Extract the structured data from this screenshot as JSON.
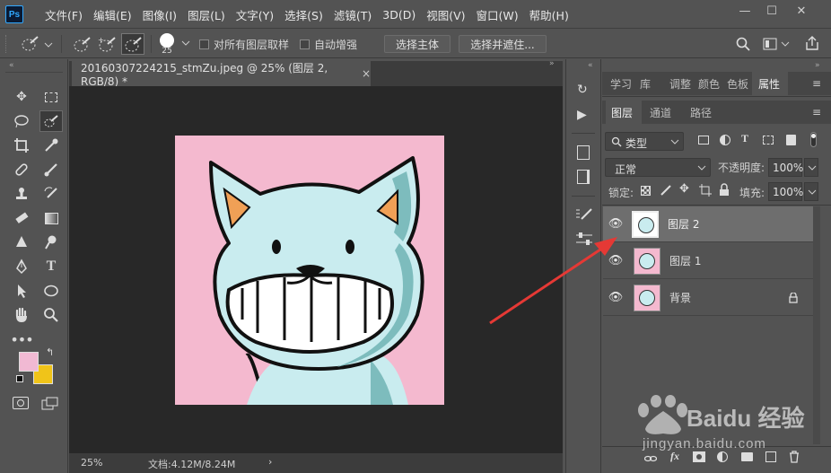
{
  "menubar": {
    "logo": "Ps",
    "items": [
      "文件(F)",
      "编辑(E)",
      "图像(I)",
      "图层(L)",
      "文字(Y)",
      "选择(S)",
      "滤镜(T)",
      "3D(D)",
      "视图(V)",
      "窗口(W)",
      "帮助(H)"
    ]
  },
  "options": {
    "brush_size": "25",
    "sample_all_label": "对所有图层取样",
    "auto_enhance_label": "自动增强",
    "select_subject_label": "选择主体",
    "select_mask_label": "选择并遮住..."
  },
  "document": {
    "tab_title": "20160307224215_stmZu.jpeg @ 25% (图层 2, RGB/8) *",
    "close": "×",
    "zoom": "25%",
    "doc_info": "文档:4.12M/8.24M",
    "arrow": "›"
  },
  "colors": {
    "foreground": "#f1b9d3",
    "background": "#f0c419",
    "accent": "#31a8ff",
    "annotation": "#e53935"
  },
  "panels": {
    "top_tabs": [
      "学习",
      "库",
      "调整",
      "颜色",
      "色板",
      "属性"
    ],
    "active_top_tab": "属性",
    "layer_tabs": [
      "图层",
      "通道",
      "路径"
    ],
    "active_layer_tab": "图层",
    "filter_kind": "类型",
    "blend_mode": "正常",
    "opacity_label": "不透明度:",
    "opacity_value": "100%",
    "lock_label": "锁定:",
    "fill_label": "填充:",
    "fill_value": "100%",
    "layers": [
      {
        "name": "图层 2",
        "selected": true,
        "locked": false
      },
      {
        "name": "图层 1",
        "selected": false,
        "locked": false
      },
      {
        "name": "背景",
        "selected": false,
        "locked": true
      }
    ],
    "bottom_icons": [
      "link-icon",
      "fx-icon",
      "mask-icon",
      "adjustment-icon",
      "group-icon",
      "new-layer-icon",
      "trash-icon"
    ],
    "fx_label": "fx"
  },
  "watermark": {
    "line1": "Baidu 经验",
    "line2": "jingyan.baidu.com"
  }
}
